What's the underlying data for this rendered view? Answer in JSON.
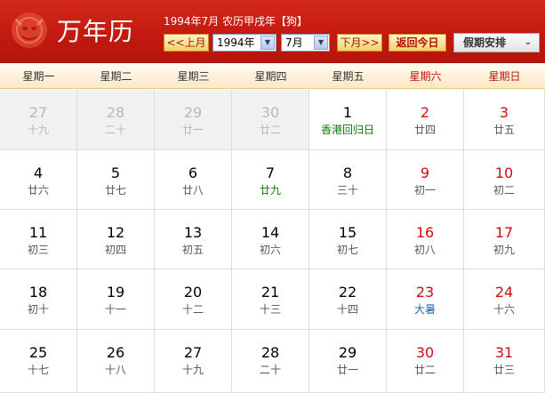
{
  "header": {
    "title": "万年历",
    "info": "1994年7月 农历甲戌年【狗】",
    "prev_label": "<<上月",
    "next_label": "下月>>",
    "year_value": "1994年",
    "month_value": "7月",
    "today_label": "返回今日",
    "holiday_label": "假期安排"
  },
  "colors": {
    "header_red": "#c21a10",
    "weekend_red": "#d10d0d",
    "festival_green": "#0c7a0c",
    "solar_term_blue": "#1a66b8"
  },
  "weekdays": [
    "星期一",
    "星期二",
    "星期三",
    "星期四",
    "星期五",
    "星期六",
    "星期日"
  ],
  "weeks": [
    [
      {
        "day": "27",
        "lunar": "十九",
        "other": true
      },
      {
        "day": "28",
        "lunar": "二十",
        "other": true
      },
      {
        "day": "29",
        "lunar": "廿一",
        "other": true
      },
      {
        "day": "30",
        "lunar": "廿二",
        "other": true
      },
      {
        "day": "1",
        "lunar": "香港回归日",
        "type": "festival"
      },
      {
        "day": "2",
        "lunar": "廿四",
        "weekend": true
      },
      {
        "day": "3",
        "lunar": "廿五",
        "weekend": true
      }
    ],
    [
      {
        "day": "4",
        "lunar": "廿六"
      },
      {
        "day": "5",
        "lunar": "廿七"
      },
      {
        "day": "6",
        "lunar": "廿八"
      },
      {
        "day": "7",
        "lunar": "廿九",
        "type": "festival"
      },
      {
        "day": "8",
        "lunar": "三十"
      },
      {
        "day": "9",
        "lunar": "初一",
        "weekend": true
      },
      {
        "day": "10",
        "lunar": "初二",
        "weekend": true
      }
    ],
    [
      {
        "day": "11",
        "lunar": "初三"
      },
      {
        "day": "12",
        "lunar": "初四"
      },
      {
        "day": "13",
        "lunar": "初五"
      },
      {
        "day": "14",
        "lunar": "初六"
      },
      {
        "day": "15",
        "lunar": "初七"
      },
      {
        "day": "16",
        "lunar": "初八",
        "weekend": true
      },
      {
        "day": "17",
        "lunar": "初九",
        "weekend": true
      }
    ],
    [
      {
        "day": "18",
        "lunar": "初十"
      },
      {
        "day": "19",
        "lunar": "十一"
      },
      {
        "day": "20",
        "lunar": "十二"
      },
      {
        "day": "21",
        "lunar": "十三"
      },
      {
        "day": "22",
        "lunar": "十四"
      },
      {
        "day": "23",
        "lunar": "大暑",
        "weekend": true,
        "type": "term"
      },
      {
        "day": "24",
        "lunar": "十六",
        "weekend": true
      }
    ],
    [
      {
        "day": "25",
        "lunar": "十七"
      },
      {
        "day": "26",
        "lunar": "十八"
      },
      {
        "day": "27",
        "lunar": "十九"
      },
      {
        "day": "28",
        "lunar": "二十"
      },
      {
        "day": "29",
        "lunar": "廿一"
      },
      {
        "day": "30",
        "lunar": "廿二",
        "weekend": true
      },
      {
        "day": "31",
        "lunar": "廿三",
        "weekend": true
      }
    ]
  ]
}
